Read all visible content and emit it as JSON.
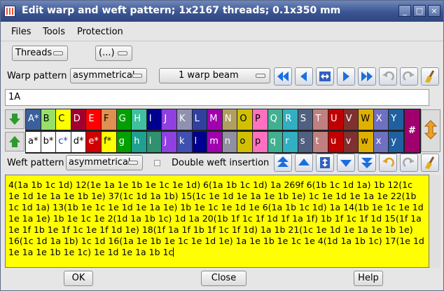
{
  "window": {
    "title": "Edit warp and weft pattern; 1x2167 threads; 0.1x350 mm"
  },
  "menu": {
    "files": "Files",
    "tools": "Tools",
    "protection": "Protection"
  },
  "toolbar1": {
    "threads": "Threads",
    "ellipsis": "(...)"
  },
  "warp": {
    "label": "Warp pattern",
    "mode": "asymmetrical",
    "beam": "1 warp beam",
    "pattern_value": "1A"
  },
  "palette": {
    "top": [
      {
        "label": "A*",
        "color": "#3a5f9a",
        "text": "#ffffff"
      },
      {
        "label": "B",
        "color": "#96e06a",
        "text": "#000000"
      },
      {
        "label": "C",
        "color": "#ffff00",
        "text": "#000000"
      },
      {
        "label": "D",
        "color": "#a00030",
        "text": "#ffffff"
      },
      {
        "label": "E",
        "color": "#ff0000",
        "text": "#ffffff"
      },
      {
        "label": "F",
        "color": "#e09050",
        "text": "#000000"
      },
      {
        "label": "G",
        "color": "#00a000",
        "text": "#ffffff"
      },
      {
        "label": "H",
        "color": "#40c0a0",
        "text": "#ffffff"
      },
      {
        "label": "I",
        "color": "#000090",
        "text": "#ffffff"
      },
      {
        "label": "J",
        "color": "#9040e0",
        "text": "#ffffff"
      },
      {
        "label": "K",
        "color": "#9090b0",
        "text": "#ffffff"
      },
      {
        "label": "L",
        "color": "#3040a0",
        "text": "#ffffff"
      },
      {
        "label": "M",
        "color": "#a000b0",
        "text": "#ffffff"
      },
      {
        "label": "N",
        "color": "#b0a060",
        "text": "#ffffff"
      },
      {
        "label": "O",
        "color": "#d0c000",
        "text": "#000000"
      },
      {
        "label": "P",
        "color": "#ff70c0",
        "text": "#000000"
      },
      {
        "label": "Q",
        "color": "#40b090",
        "text": "#ffffff"
      },
      {
        "label": "R",
        "color": "#30b0c0",
        "text": "#ffffff"
      },
      {
        "label": "S",
        "color": "#506080",
        "text": "#ffffff"
      },
      {
        "label": "T",
        "color": "#c08080",
        "text": "#ffffff"
      },
      {
        "label": "U",
        "color": "#c00000",
        "text": "#ffffff"
      },
      {
        "label": "V",
        "color": "#803030",
        "text": "#ffffff"
      },
      {
        "label": "W",
        "color": "#e0b000",
        "text": "#000000"
      },
      {
        "label": "X",
        "color": "#7070c0",
        "text": "#ffffff"
      },
      {
        "label": "Y",
        "color": "#2060a0",
        "text": "#ffffff"
      }
    ],
    "bottom": [
      {
        "label": "a*",
        "color": "#ffffff",
        "text": "#000000"
      },
      {
        "label": "b*",
        "color": "#ffffff",
        "text": "#000000"
      },
      {
        "label": "c*",
        "color": "#ffffff",
        "text": "#2040c0"
      },
      {
        "label": "d*",
        "color": "#ffffff",
        "text": "#000000"
      },
      {
        "label": "e*",
        "color": "#d00000",
        "text": "#ffffff"
      },
      {
        "label": "f*",
        "color": "#ffff00",
        "text": "#000000"
      },
      {
        "label": "g",
        "color": "#00a000",
        "text": "#ffffff"
      },
      {
        "label": "h",
        "color": "#20a090",
        "text": "#ffffff"
      },
      {
        "label": "i",
        "color": "#309070",
        "text": "#ffffff"
      },
      {
        "label": "j",
        "color": "#9040e0",
        "text": "#ffffff"
      },
      {
        "label": "k",
        "color": "#4050b0",
        "text": "#ffffff"
      },
      {
        "label": "l",
        "color": "#000090",
        "text": "#ffffff"
      },
      {
        "label": "m",
        "color": "#a000b0",
        "text": "#ffffff"
      },
      {
        "label": "n",
        "color": "#9090a0",
        "text": "#ffffff"
      },
      {
        "label": "o",
        "color": "#d0c000",
        "text": "#000000"
      },
      {
        "label": "p",
        "color": "#ff70c0",
        "text": "#000000"
      },
      {
        "label": "q",
        "color": "#40b090",
        "text": "#ffffff"
      },
      {
        "label": "r",
        "color": "#30b0c0",
        "text": "#ffffff"
      },
      {
        "label": "s",
        "color": "#506080",
        "text": "#ffffff"
      },
      {
        "label": "t",
        "color": "#c08080",
        "text": "#ffffff"
      },
      {
        "label": "u",
        "color": "#c00000",
        "text": "#ffffff"
      },
      {
        "label": "v",
        "color": "#803030",
        "text": "#ffffff"
      },
      {
        "label": "w",
        "color": "#e0b000",
        "text": "#000000"
      },
      {
        "label": "x",
        "color": "#7070c0",
        "text": "#ffffff"
      },
      {
        "label": "y",
        "color": "#2060a0",
        "text": "#ffffff"
      }
    ],
    "hash_label": "#"
  },
  "weft": {
    "label": "Weft pattern",
    "mode": "asymmetrical",
    "double_insertion_label": "Double weft insertion",
    "pattern_text": "4(1a 1b 1c 1d) 12(1e 1a 1e 1b 1e 1c 1e 1d) 6(1a 1b 1c 1d) 1a 269f 6(1b 1c 1d 1a) 1b 12(1c 1e 1d 1e 1a 1e 1b 1e) 37(1c 1d 1a 1b) 15(1c 1e 1d 1e 1a 1e 1b 1e) 1c 1e 1d 1e 1a 1e 22(1b 1c 1d 1a) 13(1b 1e 1c 1e 1d 1e 1a 1e) 1b 1e 1c 1e 1d 1e 6(1a 1b 1c 1d) 1a 14(1b 1e 1c 1e 1d 1e 1a 1e) 1b 1e 1c 1e 2(1d 1a 1b 1c) 1d 1a 20(1b 1f 1c 1f 1d 1f 1a 1f) 1b 1f 1c 1f 1d 15(1f 1a 1e 1f 1b 1e 1f 1c 1e 1f 1d 1e) 18(1f 1a 1f 1b 1f 1c 1f 1d) 1a 1b 21(1c 1e 1d 1e 1a 1e 1b 1e) 16(1c 1d 1a 1b) 1c 1d 16(1a 1e 1b 1e 1c 1e 1d 1e) 1a 1e 1b 1e 1c 1e 4(1d 1a 1b 1c) 17(1e 1d 1e 1a 1e 1b 1e 1c) 1e 1d 1e 1a 1b 1c"
  },
  "footer": {
    "ok": "OK",
    "close": "Close",
    "help": "Help"
  }
}
